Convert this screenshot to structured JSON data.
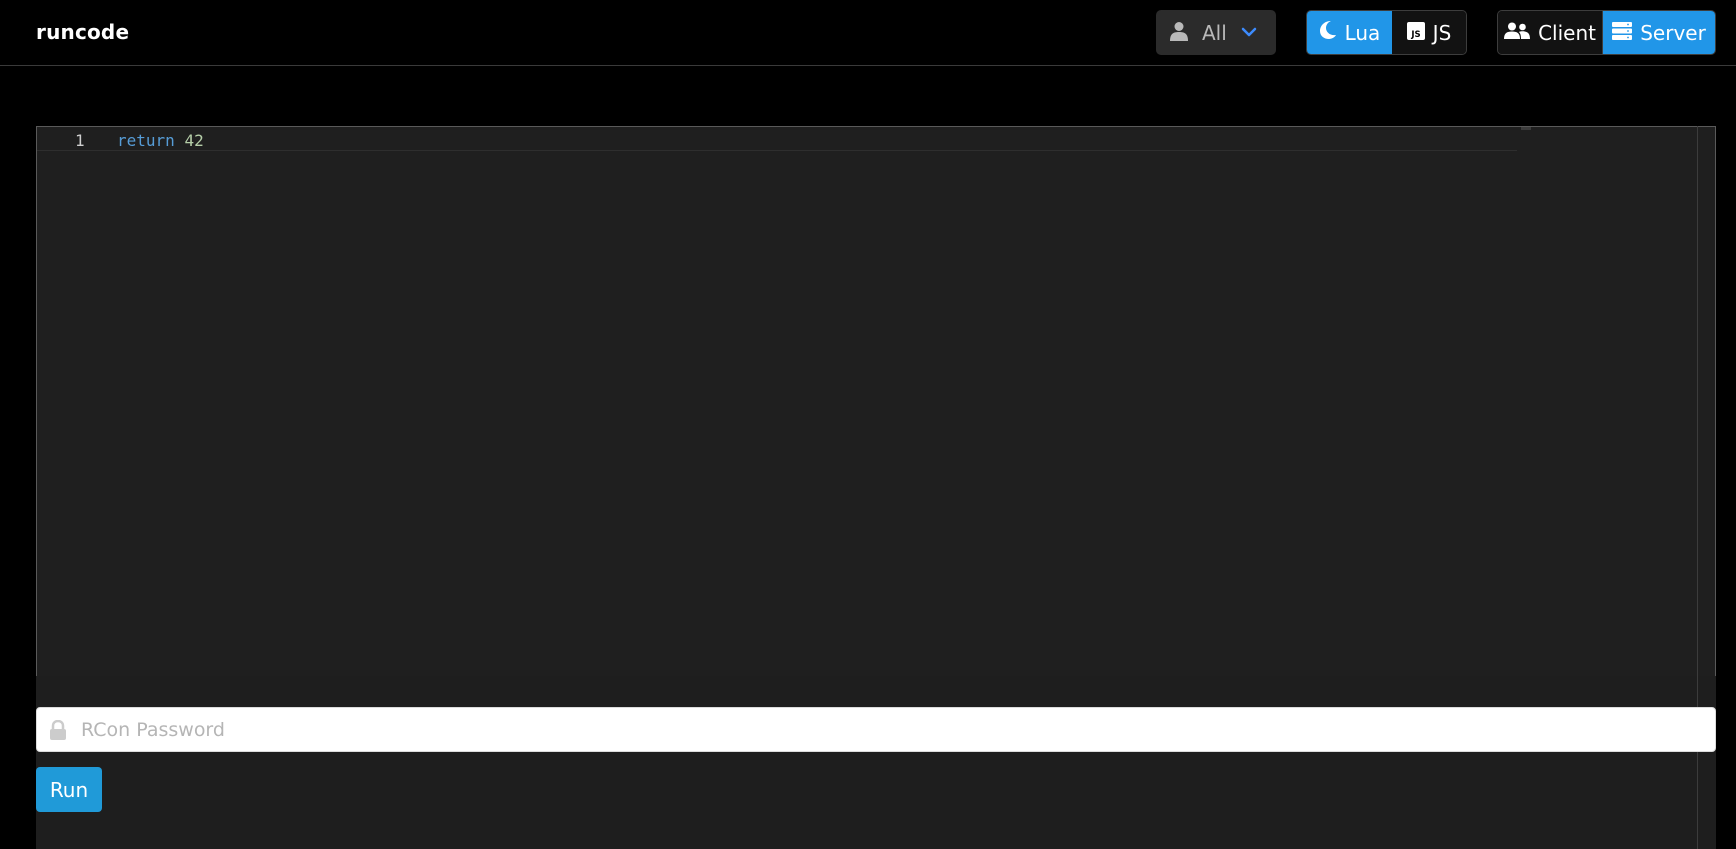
{
  "app": {
    "brand": "runcode"
  },
  "header": {
    "target_dropdown": {
      "selected": "All",
      "icon": "user-icon"
    },
    "language": [
      {
        "label": "Lua",
        "icon": "moon-icon",
        "active": true
      },
      {
        "label": "JS",
        "icon": "js-icon",
        "active": false
      }
    ],
    "realm": [
      {
        "label": "Client",
        "icon": "users-icon",
        "active": false
      },
      {
        "label": "Server",
        "icon": "server-icon",
        "active": true
      }
    ]
  },
  "editor": {
    "lines": [
      {
        "number": "1",
        "keyword": "return",
        "value": "42"
      }
    ]
  },
  "rcon": {
    "placeholder": "RCon Password",
    "value": ""
  },
  "actions": {
    "run_label": "Run"
  },
  "colors": {
    "accent": "#2196e8",
    "run_button": "#209ad8",
    "keyword": "#569cd6",
    "number": "#b5cea8"
  }
}
